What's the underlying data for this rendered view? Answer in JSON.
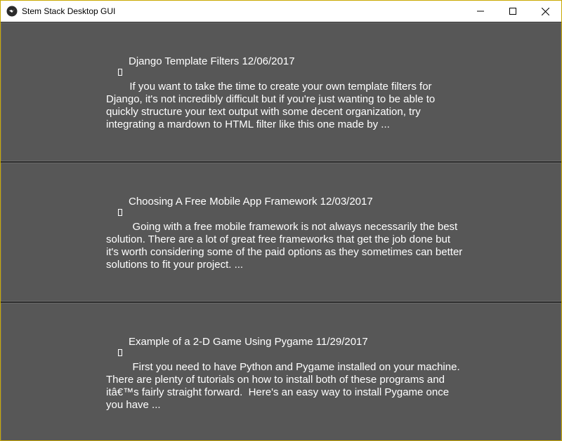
{
  "window": {
    "title": "Stem Stack Desktop GUI"
  },
  "posts": [
    {
      "title": "Django Template Filters 12/06/2017",
      "body": "        If you want to take the time to create your own template filters for Django, it's not incredibly difficult but if you're just wanting to be able to quickly structure your text output with some decent organization, try integrating a mardown to HTML filter like this one made by ..."
    },
    {
      "title": "Choosing A Free Mobile App Framework 12/03/2017",
      "body": "         Going with a free mobile framework is not always necessarily the best solution. There are a lot of great free frameworks that get the job done but it's worth considering some of the paid options as they sometimes can better solutions to fit your project. ..."
    },
    {
      "title": "Example of a 2-D Game Using Pygame 11/29/2017",
      "body": "         First you need to have Python and Pygame installed on your machine. There are plenty of tutorials on how to install both of these programs and itâ€™s fairly straight forward.  Here's an easy way to install Pygame once you have ..."
    }
  ]
}
